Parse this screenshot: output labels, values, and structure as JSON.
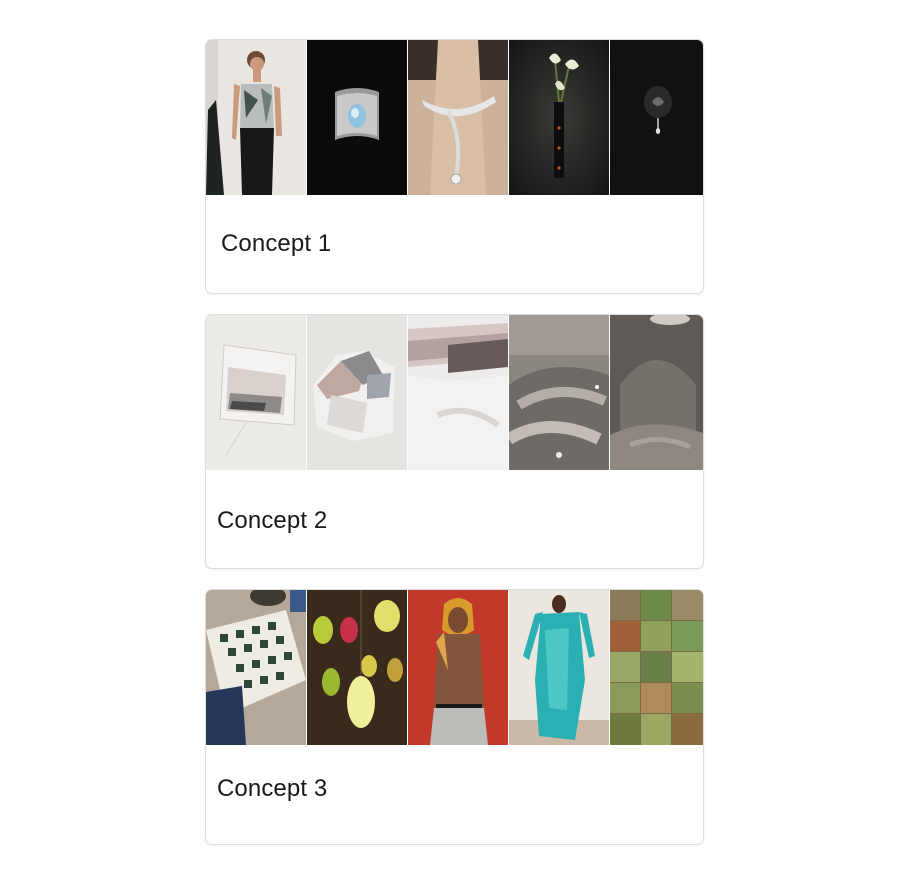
{
  "concepts": [
    {
      "title": "Concept 1",
      "thumbnails": [
        {
          "icon": "woman-in-strapless-top-photo"
        },
        {
          "icon": "silver-cuff-bracelet-photo"
        },
        {
          "icon": "silver-neck-collar-photo"
        },
        {
          "icon": "calla-lily-vase-photo"
        },
        {
          "icon": "black-pendant-photo"
        }
      ]
    },
    {
      "title": "Concept 2",
      "thumbnails": [
        {
          "icon": "sheer-fabric-bag-photo"
        },
        {
          "icon": "folded-silk-pouch-photo"
        },
        {
          "icon": "stacked-fabric-closeup-photo"
        },
        {
          "icon": "curved-concrete-interior-photo"
        },
        {
          "icon": "domed-stone-room-photo"
        }
      ]
    },
    {
      "title": "Concept 3",
      "thumbnails": [
        {
          "icon": "checkered-rug-still-life-photo"
        },
        {
          "icon": "colorful-lanterns-photo"
        },
        {
          "icon": "man-with-headscarf-photo"
        },
        {
          "icon": "teal-knit-garment-photo"
        },
        {
          "icon": "green-tile-mosaic-photo"
        }
      ]
    }
  ]
}
